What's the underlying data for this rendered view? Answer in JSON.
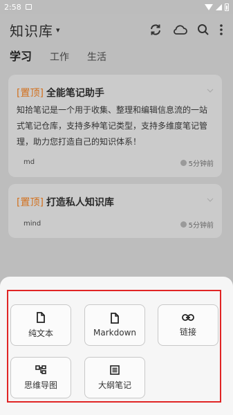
{
  "status": {
    "time": "2:58"
  },
  "header": {
    "title": "知识库",
    "caret": "▾"
  },
  "tabs": [
    "学习",
    "工作",
    "生活"
  ],
  "notes": [
    {
      "pin": "[置顶]",
      "title": "全能笔记助手",
      "body": "知拾笔记是一个用于收集、整理和编辑信息流的一站式笔记仓库，支持多种笔记类型，支持多维度笔记管理，助力您打造自己的知识体系！",
      "tag": "md",
      "time": "5分钟前"
    },
    {
      "pin": "[置顶]",
      "title": "打造私人知识库",
      "tag": "mind",
      "time": "5分钟前"
    }
  ],
  "new_note_options": [
    {
      "label": "纯文本",
      "icon": "file-icon"
    },
    {
      "label": "Markdown",
      "icon": "file-icon"
    },
    {
      "label": "链接",
      "icon": "link-icon"
    },
    {
      "label": "思维导图",
      "icon": "mindmap-icon"
    },
    {
      "label": "大纲笔记",
      "icon": "outline-icon"
    }
  ],
  "colors": {
    "pin": "#d2701e",
    "highlight_box": "#e02424",
    "overlay": "#bdbdbd"
  }
}
